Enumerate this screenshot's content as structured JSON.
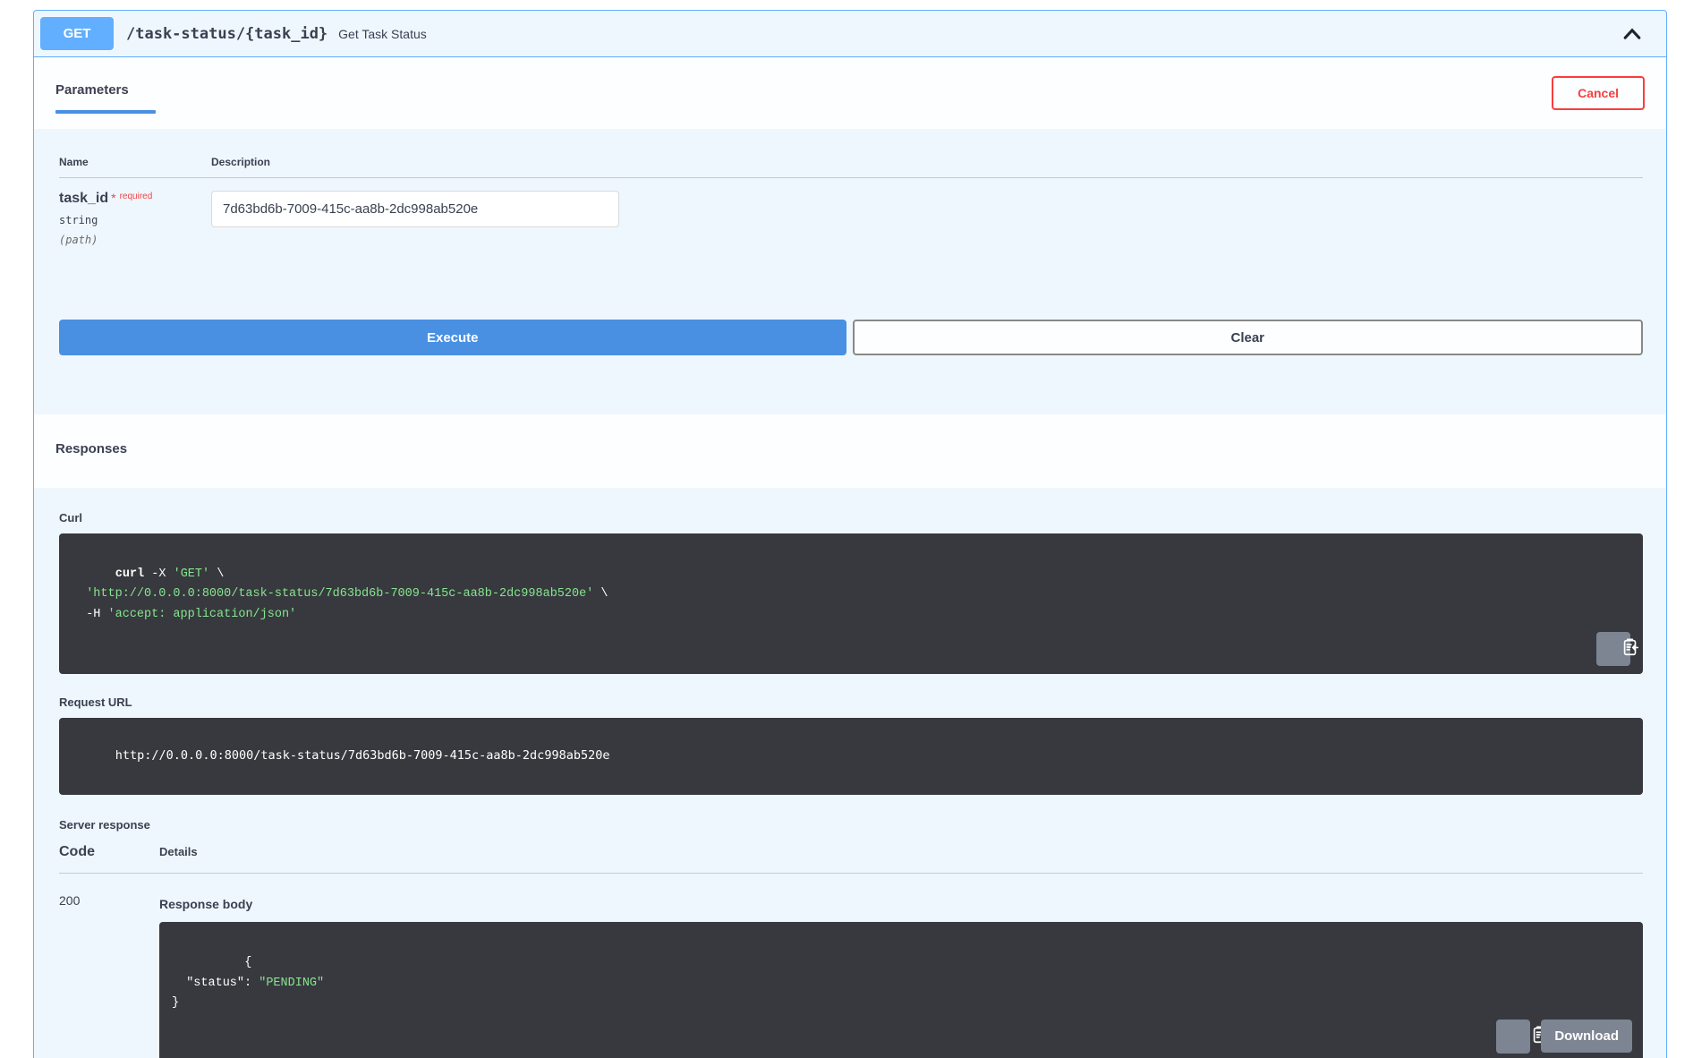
{
  "endpoint": {
    "method": "GET",
    "path": "/task-status/{task_id}",
    "summary": "Get Task Status"
  },
  "header": {
    "parameters_tab": "Parameters",
    "cancel_label": "Cancel"
  },
  "parameters": {
    "name_col": "Name",
    "description_col": "Description",
    "param": {
      "name": "task_id",
      "required_star": "*",
      "required_label": "required",
      "type": "string",
      "location": "(path)",
      "value": "7d63bd6b-7009-415c-aa8b-2dc998ab520e"
    }
  },
  "actions": {
    "execute": "Execute",
    "clear": "Clear"
  },
  "responses": {
    "title": "Responses",
    "curl_label": "Curl",
    "curl_lines": [
      [
        {
          "t": "curl",
          "c": "cmd"
        },
        {
          "t": " -X ",
          "c": "plain"
        },
        {
          "t": "'GET'",
          "c": "string"
        },
        {
          "t": " \\",
          "c": "plain"
        }
      ],
      [
        {
          "t": "  ",
          "c": "plain"
        },
        {
          "t": "'http://0.0.0.0:8000/task-status/7d63bd6b-7009-415c-aa8b-2dc998ab520e'",
          "c": "string"
        },
        {
          "t": " \\",
          "c": "plain"
        }
      ],
      [
        {
          "t": "  -H ",
          "c": "plain"
        },
        {
          "t": "'accept: application/json'",
          "c": "string"
        }
      ]
    ],
    "request_url_label": "Request URL",
    "request_url": "http://0.0.0.0:8000/task-status/7d63bd6b-7009-415c-aa8b-2dc998ab520e",
    "server_response_label": "Server response",
    "code_col": "Code",
    "details_col": "Details",
    "status_code": "200",
    "response_body_label": "Response body",
    "response_lines": [
      [
        {
          "t": "{",
          "c": "plain"
        }
      ],
      [
        {
          "t": "  \"status\"",
          "c": "plain"
        },
        {
          "t": ": ",
          "c": "plain"
        },
        {
          "t": "\"PENDING\"",
          "c": "string"
        }
      ],
      [
        {
          "t": "}",
          "c": "plain"
        }
      ]
    ],
    "download_label": "Download"
  },
  "colors": {
    "method_get_blue": "#61affe",
    "execute_blue": "#4990e2",
    "cancel_red": "#f93e3e",
    "string_green": "#86e58e",
    "code_background": "#37393e"
  }
}
